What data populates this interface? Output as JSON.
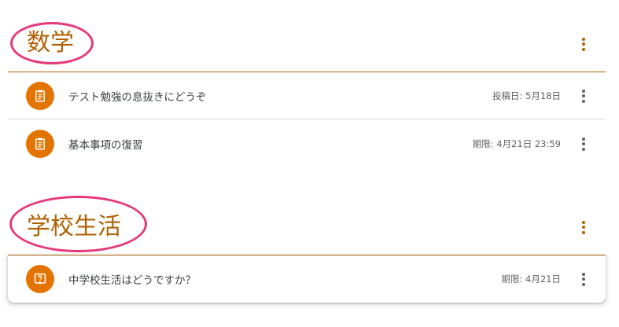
{
  "colors": {
    "accent": "#b06000",
    "icon_bg": "#e37400",
    "annotation_circle": "#e6397a",
    "text": "#3c4043",
    "meta_text": "#5f6368"
  },
  "topics": [
    {
      "title": "数学",
      "items": [
        {
          "icon": "assignment-icon",
          "title": "テスト勉強の息抜きにどうぞ",
          "meta": "投稿日: 5月18日"
        },
        {
          "icon": "assignment-icon",
          "title": "基本事項の復習",
          "meta": "期限: 4月21日 23:59"
        }
      ]
    },
    {
      "title": "学校生活",
      "items": [
        {
          "icon": "question-icon",
          "title": "中学校生活はどうですか？",
          "meta": "期限: 4月21日"
        }
      ]
    }
  ]
}
